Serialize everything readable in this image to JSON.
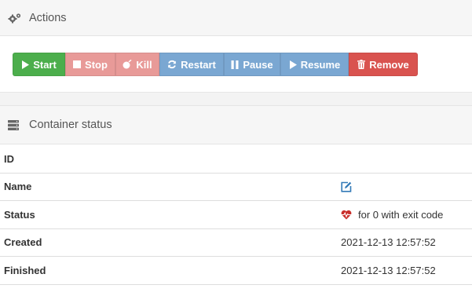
{
  "actions": {
    "title": "Actions",
    "icon": "cogs-icon",
    "buttons": {
      "start": "Start",
      "stop": "Stop",
      "kill": "Kill",
      "restart": "Restart",
      "pause": "Pause",
      "resume": "Resume",
      "remove": "Remove"
    }
  },
  "container_status": {
    "title": "Container status",
    "icon": "server-icon",
    "rows": [
      {
        "key": "ID",
        "value": ""
      },
      {
        "key": "Name",
        "value": "",
        "icon": "edit-icon"
      },
      {
        "key": "Status",
        "value": "for 0 with exit code",
        "icon": "heartbeat-icon"
      },
      {
        "key": "Created",
        "value": "2021-12-13 12:57:52"
      },
      {
        "key": "Finished",
        "value": "2021-12-13 12:57:52"
      }
    ]
  },
  "colors": {
    "start": "#4cae4c",
    "stop_kill": "#e89a98",
    "restart_pause_resume": "#7aa7d2",
    "remove": "#d9534f",
    "edit_icon": "#337ab7",
    "heart_icon": "#c9302c"
  }
}
